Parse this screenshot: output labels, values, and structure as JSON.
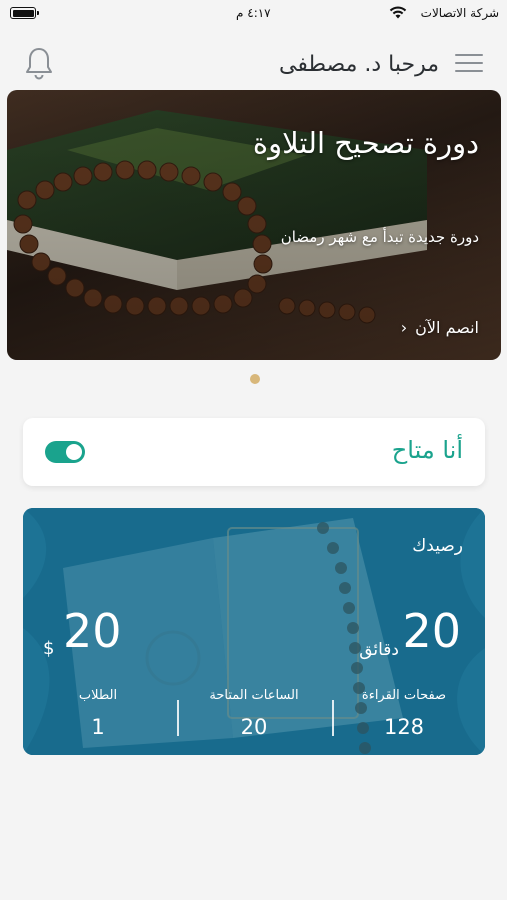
{
  "status_bar": {
    "carrier": "شركة الاتصالات",
    "time": "٤:١٧ م"
  },
  "header": {
    "greeting": "مرحبا د. مصطفى",
    "menu_icon": "hamburger-menu-icon",
    "notification_icon": "bell-icon"
  },
  "banner": {
    "title": "دورة تصحيح التلاوة",
    "subtitle": "دورة جديدة تبدأ مع شهر رمضان",
    "cta": "انصم الآن",
    "cta_icon": "chevron-left-icon"
  },
  "availability": {
    "label": "أنا متاح",
    "enabled": true
  },
  "balance": {
    "label": "رصيدك",
    "minutes_value": "20",
    "minutes_unit": "دقائق",
    "money_value": "20",
    "money_unit": "$",
    "stats": {
      "pages_label": "صفحات القراءة",
      "pages_value": "128",
      "hours_label": "الساعات المتاحة",
      "hours_value": "20",
      "students_label": "الطلاب",
      "students_value": "1"
    }
  },
  "colors": {
    "accent": "#1aa38d",
    "card_blue": "#1d6d8e",
    "dot": "#d8b77a"
  }
}
